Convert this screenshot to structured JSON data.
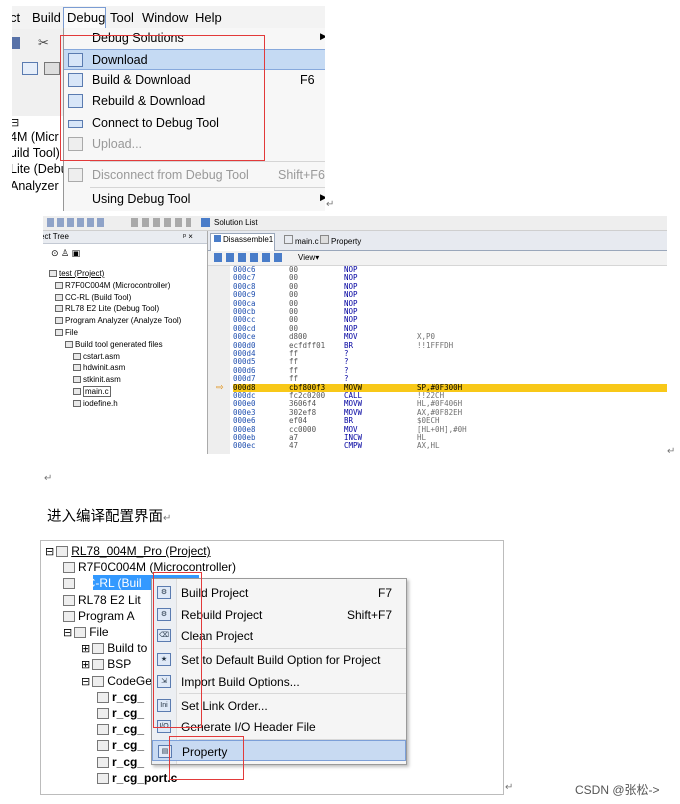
{
  "menu_bar": {
    "items": [
      {
        "id": "ct",
        "label": "ct"
      },
      {
        "id": "build",
        "label": "Build"
      },
      {
        "id": "debug",
        "label": "Debug"
      },
      {
        "id": "tool",
        "label": "Tool"
      },
      {
        "id": "window",
        "label": "Window"
      },
      {
        "id": "help",
        "label": "Help"
      }
    ]
  },
  "left_fragments": [
    "4M (Micr",
    "uild Tool)",
    "Lite (Debu",
    "Analyzer"
  ],
  "debug_menu": {
    "items": [
      {
        "label": "Debug Solutions",
        "shortcut": "",
        "submenu": true,
        "enabled": true
      },
      {
        "label": "Download",
        "shortcut": "",
        "submenu": false,
        "enabled": true,
        "highlighted": true
      },
      {
        "label": "Build & Download",
        "shortcut": "F6",
        "submenu": false,
        "enabled": true
      },
      {
        "label": "Rebuild & Download",
        "shortcut": "",
        "submenu": false,
        "enabled": true
      },
      {
        "label": "Connect to Debug Tool",
        "shortcut": "",
        "submenu": false,
        "enabled": true
      },
      {
        "label": "Upload...",
        "shortcut": "",
        "submenu": false,
        "enabled": false
      },
      {
        "label": "Disconnect from Debug Tool",
        "shortcut": "Shift+F6",
        "submenu": false,
        "enabled": false
      },
      {
        "label": "Using Debug Tool",
        "shortcut": "",
        "submenu": true,
        "enabled": true
      }
    ]
  },
  "ide": {
    "toolbar_solution_list": "Solution List",
    "project_tree_title": "ect Tree",
    "project_tree_pin": "ᵖ ×",
    "project_tree": [
      {
        "label": "test (Project)",
        "indent": 0,
        "underline": true
      },
      {
        "label": "R7F0C004M (Microcontroller)",
        "indent": 1
      },
      {
        "label": "CC-RL (Build Tool)",
        "indent": 1
      },
      {
        "label": "RL78 E2 Lite (Debug Tool)",
        "indent": 1
      },
      {
        "label": "Program Analyzer (Analyze Tool)",
        "indent": 1
      },
      {
        "label": "File",
        "indent": 1
      },
      {
        "label": "Build tool generated files",
        "indent": 2
      },
      {
        "label": "cstart.asm",
        "indent": 3
      },
      {
        "label": "hdwinit.asm",
        "indent": 3
      },
      {
        "label": "stkinit.asm",
        "indent": 3
      },
      {
        "label": "main.c",
        "indent": 3,
        "boxed": true
      },
      {
        "label": "iodefine.h",
        "indent": 3
      }
    ],
    "tabs": [
      {
        "label": "Disassemble1",
        "active": true
      },
      {
        "label": "main.c",
        "active": false
      },
      {
        "label": "Property",
        "active": false
      }
    ],
    "view_label": "View▾",
    "current_line_addr": "000d8",
    "disasm": [
      [
        "000c6",
        "00",
        "NOP",
        ""
      ],
      [
        "000c7",
        "00",
        "NOP",
        ""
      ],
      [
        "000c8",
        "00",
        "NOP",
        ""
      ],
      [
        "000c9",
        "00",
        "NOP",
        ""
      ],
      [
        "000ca",
        "00",
        "NOP",
        ""
      ],
      [
        "000cb",
        "00",
        "NOP",
        ""
      ],
      [
        "000cc",
        "00",
        "NOP",
        ""
      ],
      [
        "000cd",
        "00",
        "NOP",
        ""
      ],
      [
        "000ce",
        "d800",
        "MOV",
        "X,P0"
      ],
      [
        "000d0",
        "ecfdff01",
        "BR",
        "!!1FFFDH"
      ],
      [
        "000d4",
        "ff",
        "?",
        ""
      ],
      [
        "000d5",
        "ff",
        "?",
        ""
      ],
      [
        "000d6",
        "ff",
        "?",
        ""
      ],
      [
        "000d7",
        "ff",
        "?",
        ""
      ],
      [
        "000d8",
        "cbf800f3",
        "MOVW",
        "SP,#0F300H"
      ],
      [
        "000dc",
        "fc2c0200",
        "CALL",
        "!!22CH"
      ],
      [
        "000e0",
        "3606f4",
        "MOVW",
        "HL,#0F406H"
      ],
      [
        "000e3",
        "302ef8",
        "MOVW",
        "AX,#0F82EH"
      ],
      [
        "000e6",
        "ef04",
        "BR",
        "$0ECH"
      ],
      [
        "000e8",
        "cc0000",
        "MOV",
        "[HL+0H],#0H"
      ],
      [
        "000eb",
        "a7",
        "INCW",
        "HL"
      ],
      [
        "000ec",
        "47",
        "CMPW",
        "AX,HL"
      ]
    ]
  },
  "caption": "进入编译配置界面",
  "tree3": [
    {
      "label": "RL78_004M_Pro (Project)",
      "indent": 0,
      "expander": "⊟",
      "underline": true
    },
    {
      "label": "R7F0C004M (Microcontroller)",
      "indent": 1,
      "expander": ""
    },
    {
      "label": "CC-RL (Buil",
      "indent": 1,
      "expander": "",
      "selected": true
    },
    {
      "label": "RL78 E2 Lit",
      "indent": 1,
      "expander": ""
    },
    {
      "label": "Program A",
      "indent": 1,
      "expander": ""
    },
    {
      "label": "File",
      "indent": 1,
      "expander": "⊟"
    },
    {
      "label": "Build to",
      "indent": 2,
      "expander": "⊞"
    },
    {
      "label": "BSP",
      "indent": 2,
      "expander": "⊞"
    },
    {
      "label": "CodeGe",
      "indent": 2,
      "expander": "⊟"
    },
    {
      "label": "r_cg_",
      "indent": 3,
      "expander": "",
      "bold": true
    },
    {
      "label": "r_cg_",
      "indent": 3,
      "expander": "",
      "bold": true
    },
    {
      "label": "r_cg_",
      "indent": 3,
      "expander": "",
      "bold": true
    },
    {
      "label": "r_cg_",
      "indent": 3,
      "expander": "",
      "bold": true
    },
    {
      "label": "r_cg_",
      "indent": 3,
      "expander": "",
      "bold": true
    },
    {
      "label": "r_cg_port.c",
      "indent": 3,
      "expander": "",
      "bold": true
    }
  ],
  "context_menu": {
    "items": [
      {
        "label": "Build Project",
        "shortcut": "F7",
        "icon": "build-project-icon",
        "sep_after": false
      },
      {
        "label": "Rebuild Project",
        "shortcut": "Shift+F7",
        "icon": "rebuild-project-icon",
        "sep_after": false
      },
      {
        "label": "Clean Project",
        "shortcut": "",
        "icon": "clean-project-icon",
        "sep_after": true
      },
      {
        "label": "Set to Default Build Option for Project",
        "shortcut": "",
        "icon": "default-option-icon",
        "sep_after": false
      },
      {
        "label": "Import Build Options...",
        "shortcut": "",
        "icon": "import-options-icon",
        "sep_after": true
      },
      {
        "label": "Set Link Order...",
        "shortcut": "",
        "icon": "link-order-icon",
        "sep_after": false
      },
      {
        "label": "Generate I/O Header File",
        "shortcut": "",
        "icon": "io-header-icon",
        "sep_after": true
      },
      {
        "label": "Property",
        "shortcut": "",
        "icon": "property-icon",
        "sep_after": false,
        "highlighted": true
      }
    ]
  },
  "watermark": "CSDN @张松->",
  "colors": {
    "menu_highlight": "#c5daf3",
    "annotation_red": "#e23a3a",
    "current_line": "#f8c818",
    "tree_selection": "#3399ff"
  }
}
